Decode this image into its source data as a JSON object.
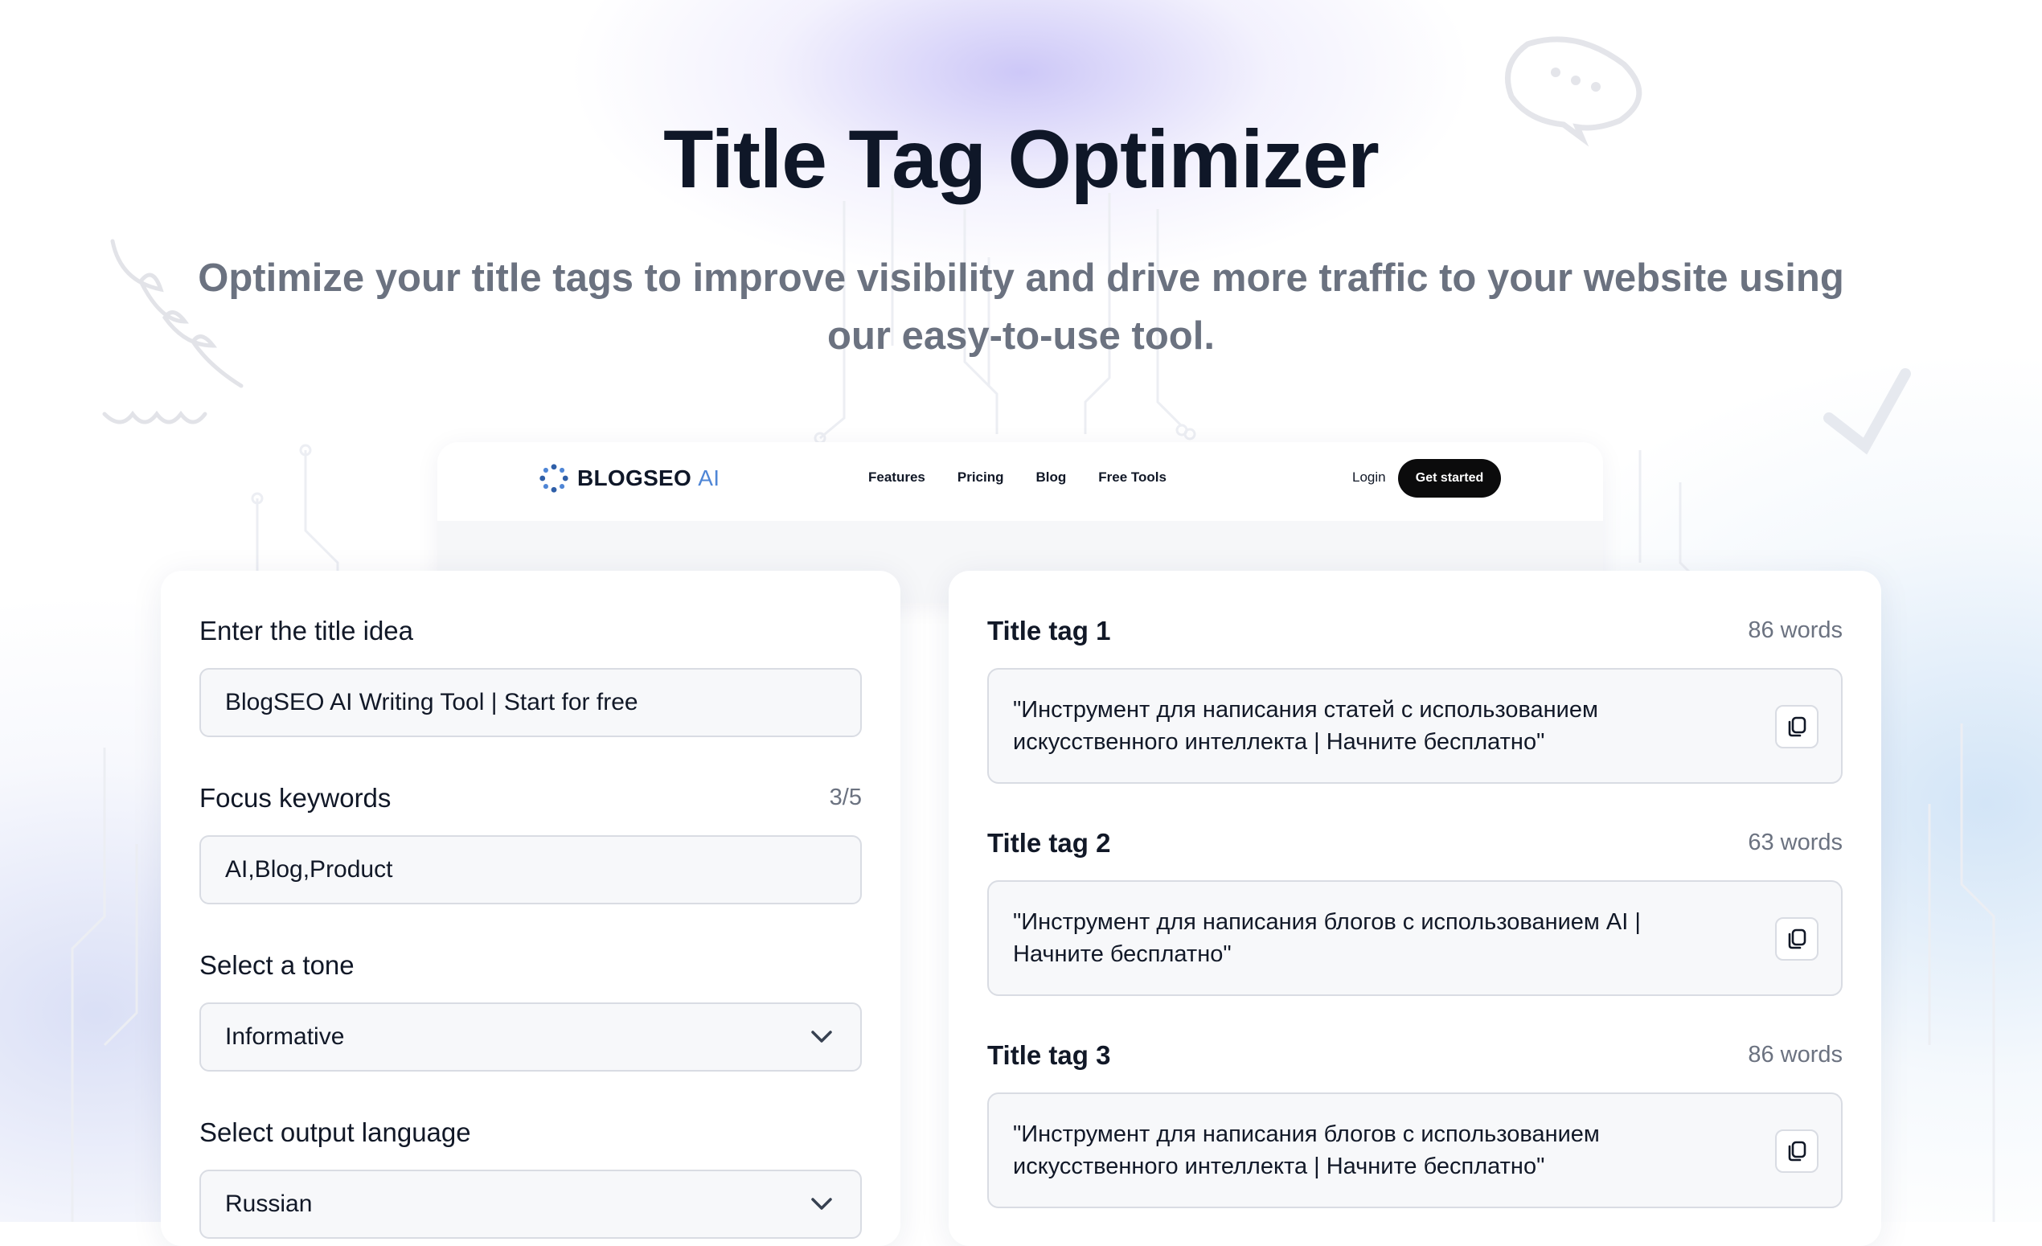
{
  "hero": {
    "title": "Title Tag Optimizer",
    "subtitle": "Optimize your title tags to improve visibility and drive more traffic to your website using our easy-to-use tool."
  },
  "preview": {
    "logo_text": "BLOGSEO",
    "logo_suffix": "AI",
    "nav": [
      "Features",
      "Pricing",
      "Blog",
      "Free Tools"
    ],
    "login": "Login",
    "cta": "Get started"
  },
  "form": {
    "title_label": "Enter the title idea",
    "title_value": "BlogSEO AI Writing Tool | Start for free",
    "keywords_label": "Focus keywords",
    "keywords_counter": "3/5",
    "keywords_value": "AI,Blog,Product",
    "tone_label": "Select a tone",
    "tone_value": "Informative",
    "language_label": "Select output language",
    "language_value": "Russian"
  },
  "results": [
    {
      "label": "Title tag 1",
      "count": "86 words",
      "text": "\"Инструмент для написания статей с использованием искусственного интеллекта | Начните бесплатно\""
    },
    {
      "label": "Title tag 2",
      "count": "63 words",
      "text": "\"Инструмент для написания блогов с использованием AI | Начните бесплатно\""
    },
    {
      "label": "Title tag 3",
      "count": "86 words",
      "text": "\"Инструмент для написания блогов с использованием искусственного интеллекта | Начните бесплатно\""
    }
  ],
  "icons": {
    "copy": "copy-icon",
    "chevron": "chevron-down-icon",
    "logo": "blogseo-logo-icon"
  }
}
